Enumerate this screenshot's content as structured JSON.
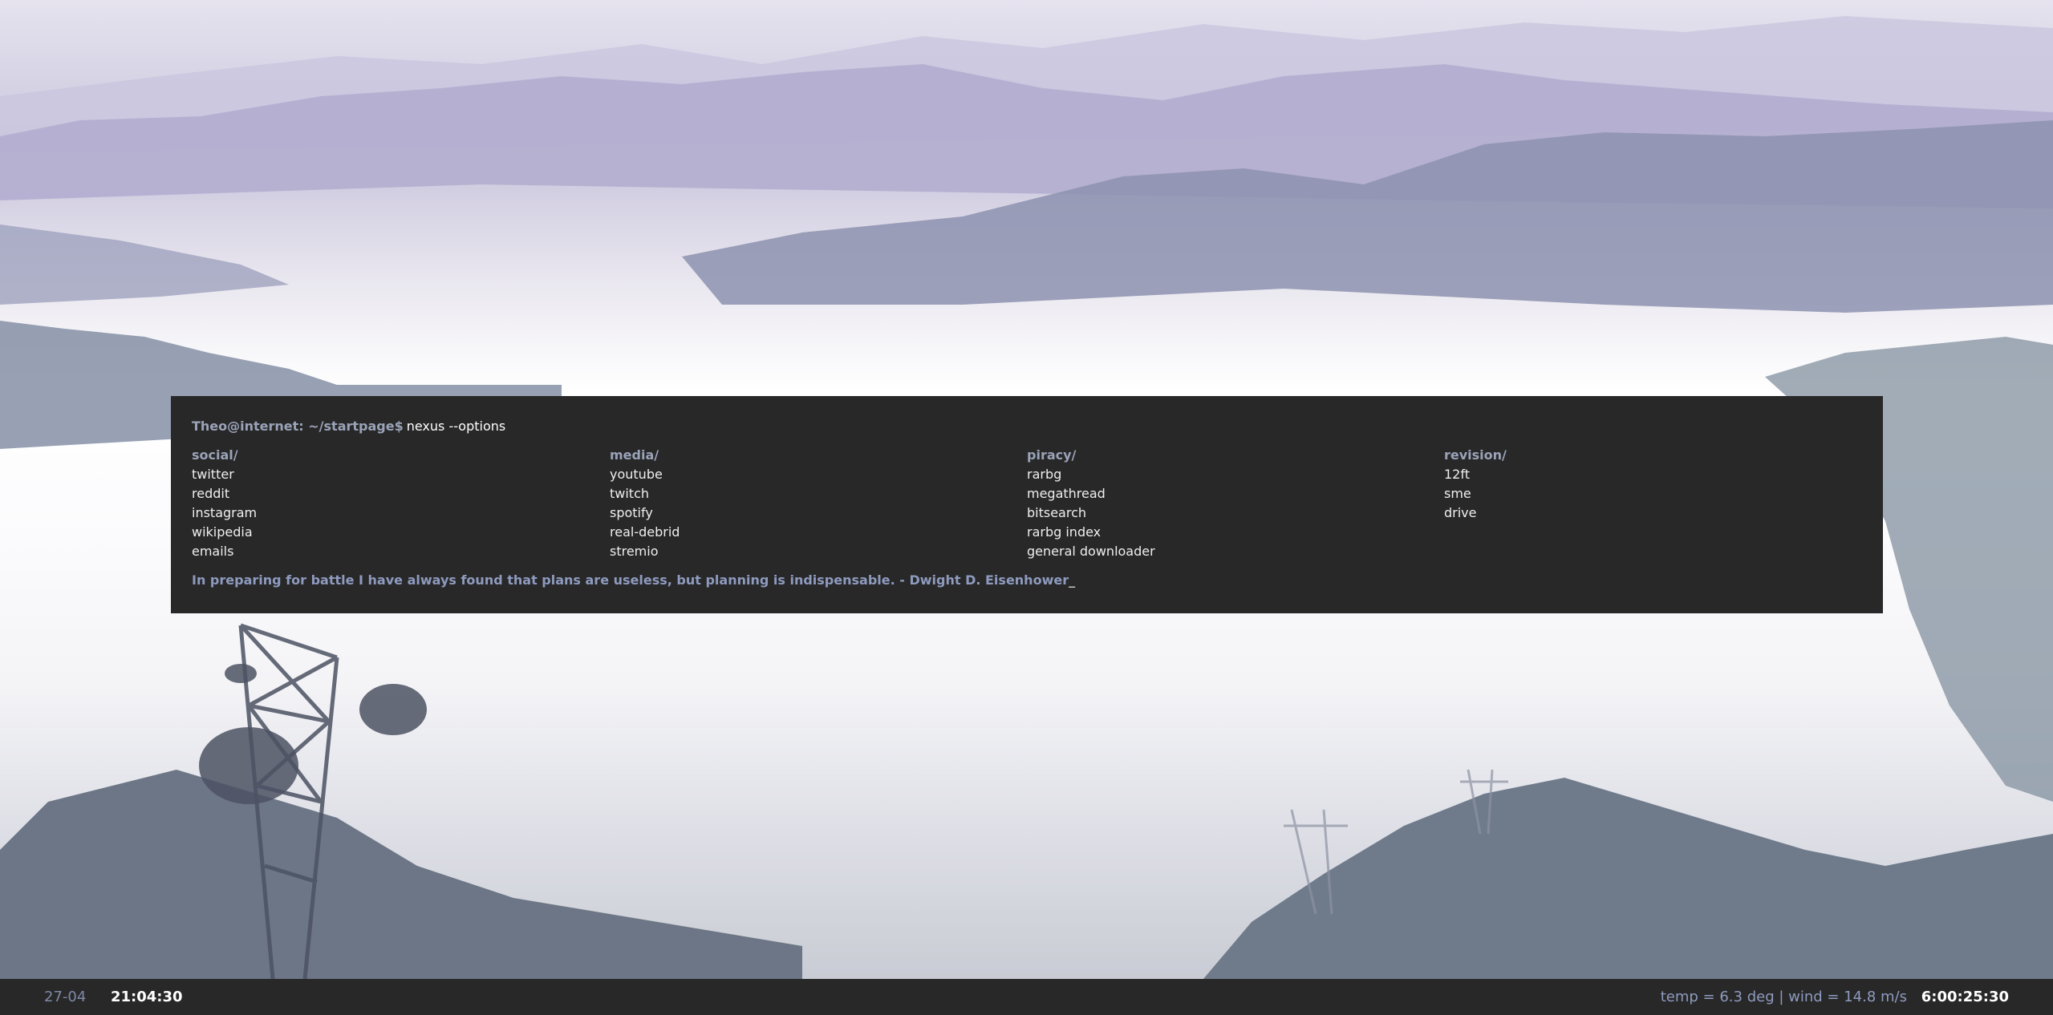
{
  "terminal": {
    "prompt": "Theo@internet: ~/startpage$",
    "command": "nexus --options",
    "columns": [
      {
        "title": "social/",
        "links": [
          "twitter",
          "reddit",
          "instagram",
          "wikipedia",
          "emails"
        ]
      },
      {
        "title": "media/",
        "links": [
          "youtube",
          "twitch",
          "spotify",
          "real-debrid",
          "stremio"
        ]
      },
      {
        "title": "piracy/",
        "links": [
          "rarbg",
          "megathread",
          "bitsearch",
          "rarbg index",
          "general downloader"
        ]
      },
      {
        "title": "revision/",
        "links": [
          "12ft",
          "sme",
          "drive"
        ]
      }
    ],
    "quote": "In preparing for battle I have always found that plans are useless, but planning is indispensable. - Dwight D. Eisenhower",
    "cursor": "_"
  },
  "statusbar": {
    "date": "27-04",
    "time": "21:04:30",
    "weather": "temp = 6.3 deg | wind = 14.8 m/s",
    "uptime": "6:00:25:30"
  },
  "colors": {
    "panel": "#282828",
    "accent": "#9aa3b8",
    "quote": "#8e9bbf"
  }
}
